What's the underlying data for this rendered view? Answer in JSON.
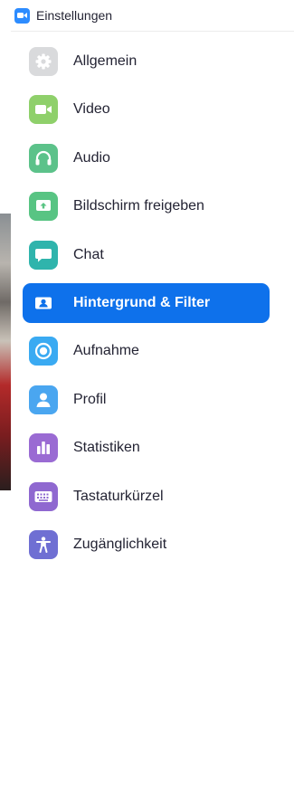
{
  "window": {
    "title": "Einstellungen",
    "app_icon": "zoom-camera-icon"
  },
  "menu": {
    "items": [
      {
        "label": "Allgemein",
        "icon": "gear-icon",
        "color": "#d9dadc"
      },
      {
        "label": "Video",
        "icon": "video-camera-icon",
        "color": "#8fd06b"
      },
      {
        "label": "Audio",
        "icon": "headphones-icon",
        "color": "#5cc28a"
      },
      {
        "label": "Bildschirm freigeben",
        "icon": "share-screen-icon",
        "color": "#58c483"
      },
      {
        "label": "Chat",
        "icon": "chat-bubble-icon",
        "color": "#2fb4ac"
      },
      {
        "label": "Hintergrund & Filter",
        "icon": "person-card-icon",
        "color": "#ffffff",
        "active": true
      },
      {
        "label": "Aufnahme",
        "icon": "record-icon",
        "color": "#3aaaf2"
      },
      {
        "label": "Profil",
        "icon": "profile-icon",
        "color": "#4aa6f0"
      },
      {
        "label": "Statistiken",
        "icon": "bar-chart-icon",
        "color": "#9a6bd3"
      },
      {
        "label": "Tastaturkürzel",
        "icon": "keyboard-icon",
        "color": "#8f68d0"
      },
      {
        "label": "Zugänglichkeit",
        "icon": "accessibility-icon",
        "color": "#6f6fd3"
      }
    ]
  },
  "colors": {
    "active_background": "#0e71eb",
    "accent": "#2d8cff"
  }
}
